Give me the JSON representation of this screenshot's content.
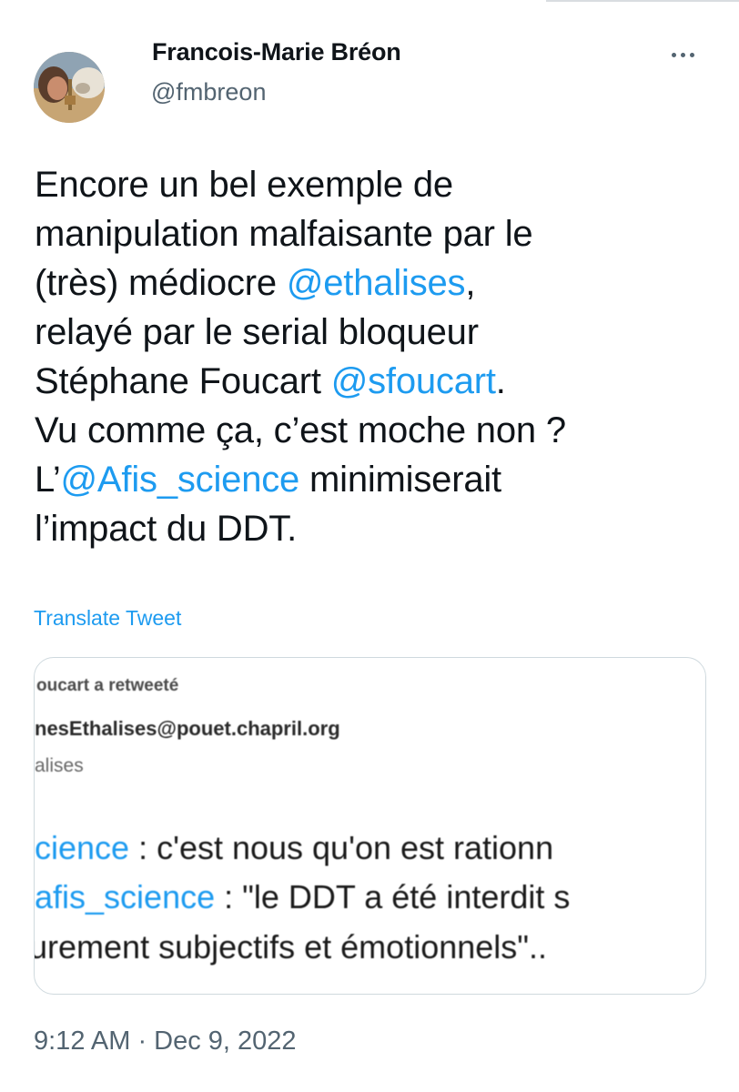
{
  "author": {
    "display_name": "Francois-Marie Bréon",
    "handle": "@fmbreon"
  },
  "menu": {
    "icon": "more-horizontal-icon"
  },
  "tweet": {
    "lines": [
      [
        {
          "text": "Encore un bel exemple de"
        }
      ],
      [
        {
          "text": "manipulation malfaisante par le"
        }
      ],
      [
        {
          "text": "(très) médiocre "
        },
        {
          "text": "@ethalises",
          "mention": true
        },
        {
          "text": ","
        }
      ],
      [
        {
          "text": "relayé par le serial bloqueur"
        }
      ],
      [
        {
          "text": "Stéphane Foucart "
        },
        {
          "text": "@sfoucart",
          "mention": true
        },
        {
          "text": "."
        }
      ],
      [
        {
          "text": "Vu comme ça, c’est moche non ?"
        }
      ],
      [
        {
          "text": "L’"
        },
        {
          "text": "@Afis_science",
          "mention": true
        },
        {
          "text": " minimiserait"
        }
      ],
      [
        {
          "text": "l’impact du DDT."
        }
      ]
    ],
    "translate_label": "Translate Tweet",
    "timestamp": "9:12 AM · Dec 9, 2022"
  },
  "embedded_image": {
    "retweet_line": "oucart a retweeté",
    "account_line": "nesEthalises@pouet.chapril.org",
    "name_line": "alises",
    "body_lines": [
      [
        {
          "text": "cience",
          "link": true
        },
        {
          "text": " : c'est nous qu'on est rationn"
        }
      ],
      [
        {
          "text": "afis_science",
          "link": true
        },
        {
          "text": " : \"le DDT a été interdit s"
        }
      ],
      [
        {
          "text": "urement subjectifs et émotionnels\".."
        }
      ]
    ]
  },
  "colors": {
    "accent": "#1d9bf0",
    "text": "#0f1419",
    "secondary": "#536471",
    "border": "#cfd9de"
  }
}
